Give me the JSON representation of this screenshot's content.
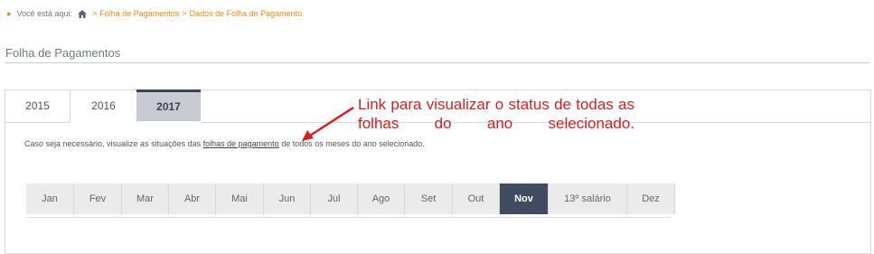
{
  "breadcrumb": {
    "prefix": "Você está aqui:",
    "items": [
      "Folha de Pagamentos",
      "Dados de Folha de Pagamento"
    ],
    "separator": ">"
  },
  "page_title": "Folha de Pagamentos",
  "year_tabs": [
    {
      "label": "2015",
      "active": false
    },
    {
      "label": "2016",
      "active": false
    },
    {
      "label": "2017",
      "active": true
    }
  ],
  "info": {
    "before": "Caso seja necessário, visualize as situações das ",
    "link": "folhas de pagamento",
    "after": " de todos os meses do ano selecionado."
  },
  "annotation": "Link para visualizar o status de todas as folhas do ano selecionado.",
  "months": [
    {
      "label": "Jan",
      "active": false
    },
    {
      "label": "Fev",
      "active": false
    },
    {
      "label": "Mar",
      "active": false
    },
    {
      "label": "Abr",
      "active": false
    },
    {
      "label": "Mai",
      "active": false
    },
    {
      "label": "Jun",
      "active": false
    },
    {
      "label": "Jul",
      "active": false
    },
    {
      "label": "Ago",
      "active": false
    },
    {
      "label": "Set",
      "active": false
    },
    {
      "label": "Out",
      "active": false
    },
    {
      "label": "Nov",
      "active": true
    },
    {
      "label": "13º salário",
      "active": false
    },
    {
      "label": "Dez",
      "active": false
    }
  ],
  "colors": {
    "accent": "#e88a1a",
    "active_tab": "#3f4b5e",
    "annotation": "#d61f1f"
  },
  "icons": {
    "breadcrumb_home": "home-icon",
    "annotation_arrow": "arrow-icon"
  }
}
